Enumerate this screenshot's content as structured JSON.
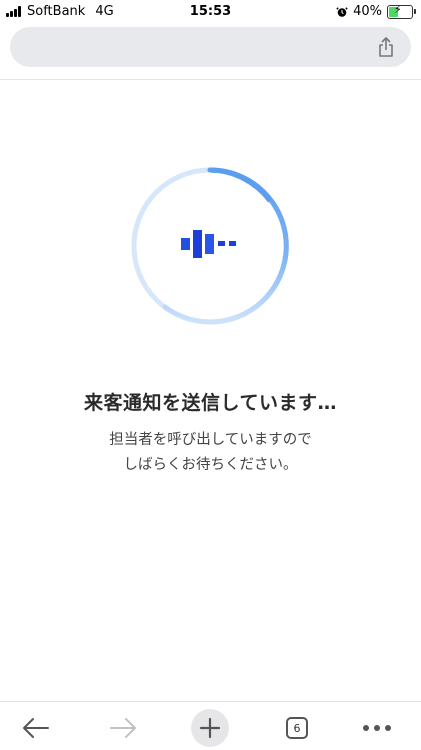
{
  "status_bar": {
    "carrier": "SoftBank",
    "network": "4G",
    "time": "15:53",
    "battery_percent": "40%",
    "battery_level": 0.4,
    "icons": [
      "signal-icon",
      "alarm-icon",
      "battery-icon",
      "charging-icon"
    ]
  },
  "browser": {
    "url_text": "",
    "share_icon": "share-icon"
  },
  "content": {
    "title": "来客通知を送信しています…",
    "message_line1": "担当者を呼び出していますので",
    "message_line2": "しばらくお待ちください。",
    "accent_color": "#1f3fd6",
    "ring_color": "#64a6f2"
  },
  "toolbar": {
    "tab_count": "6",
    "icons": [
      "back-arrow-icon",
      "forward-arrow-icon",
      "new-tab-plus-icon",
      "tabs-icon",
      "more-icon"
    ]
  }
}
